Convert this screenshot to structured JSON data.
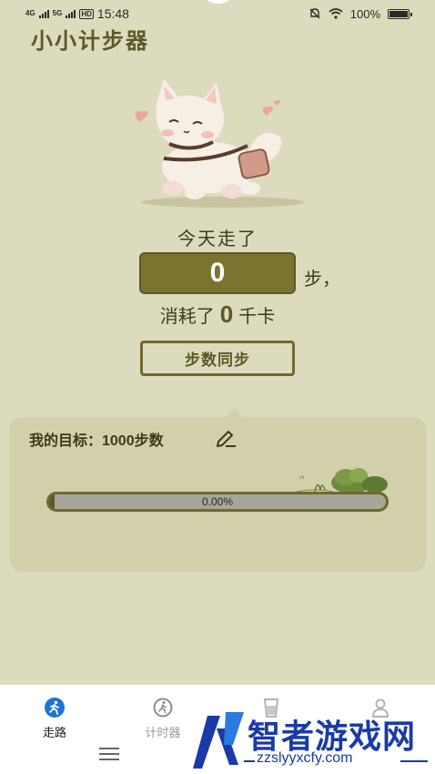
{
  "status_bar": {
    "network1": "4G",
    "network2": "5G",
    "hd": "HD",
    "time": "15:48",
    "battery": "100%"
  },
  "app": {
    "title": "小小计步器"
  },
  "today": {
    "label": "今天走了",
    "steps": "0",
    "unit": "步，",
    "calorie_prefix": "消耗了",
    "calories": "0",
    "calorie_unit": "千卡",
    "sync_label": "步数同步"
  },
  "goal": {
    "label": "我的目标：1000步数",
    "progress_text": "0.00%",
    "progress_value": 0.0
  },
  "nav": {
    "items": [
      {
        "label": "走路",
        "icon": "walk-icon",
        "active": true
      },
      {
        "label": "计时器",
        "icon": "timer-icon",
        "active": false
      },
      {
        "label": "",
        "icon": "cup-icon",
        "active": false
      },
      {
        "label": "",
        "icon": "user-icon",
        "active": false
      }
    ]
  },
  "watermark": {
    "text": "智者游戏网",
    "url": "zzslyyxcfy.com"
  },
  "colors": {
    "background": "#dddbbd",
    "accent": "#7a7430",
    "dark_olive": "#5c5828",
    "card": "#d2cfab",
    "active_nav": "#1e73d8"
  }
}
